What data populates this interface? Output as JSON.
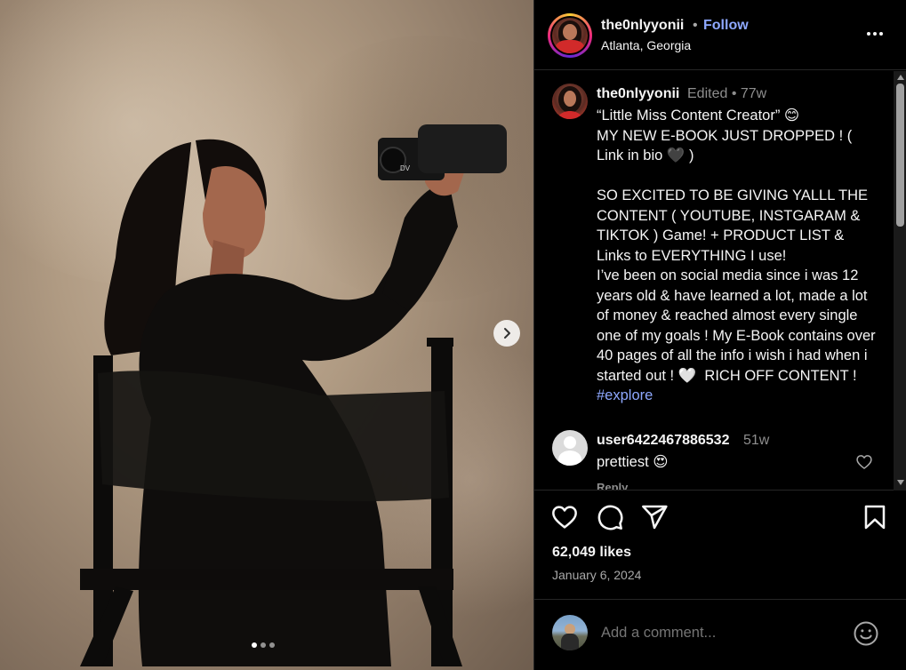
{
  "post": {
    "username": "the0nlyyonii",
    "separator": "•",
    "follow_label": "Follow",
    "location": "Atlanta, Georgia"
  },
  "caption": {
    "username": "the0nlyyonii",
    "meta": "Edited •  77w",
    "text": "“Little Miss Content Creator” 😊\nMY NEW E-BOOK JUST DROPPED ! ( Link in bio 🖤 )\n\nSO EXCITED TO BE GIVING YALLL THE CONTENT ( YOUTUBE, INSTGARAM & TIKTOK ) Game! + PRODUCT LIST & Links to EVERYTHING I use!\nI’ve been on social media since i was 12 years old & have learned a lot, made a lot of money & reached almost every single one of my goals ! My E-Book contains over 40 pages of all the info i wish i had when i started out ! 🤍  RICH OFF CONTENT ! ",
    "hashtag": "#explore"
  },
  "comment": {
    "username": "user6422467886532",
    "time": "51w",
    "text": "prettiest 😍",
    "reply_label": "Reply"
  },
  "stats": {
    "likes": "62,049 likes",
    "date": "January 6, 2024"
  },
  "add_comment": {
    "placeholder": "Add a comment..."
  },
  "carousel": {
    "slide_count": 3,
    "active_index": 1
  },
  "icons": [
    "heart-icon",
    "comment-icon",
    "share-icon",
    "bookmark-icon",
    "emoji-icon",
    "more-icon",
    "chevron-right-icon"
  ]
}
